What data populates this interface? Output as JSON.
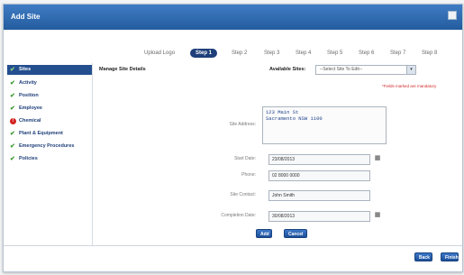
{
  "window": {
    "title": "Add Site"
  },
  "steps": [
    {
      "label": "Upload Logo",
      "current": false
    },
    {
      "label": "Step 1",
      "current": true
    },
    {
      "label": "Step 2",
      "current": false
    },
    {
      "label": "Step 3",
      "current": false
    },
    {
      "label": "Step 4",
      "current": false
    },
    {
      "label": "Step 5",
      "current": false
    },
    {
      "label": "Step 6",
      "current": false
    },
    {
      "label": "Step 7",
      "current": false
    },
    {
      "label": "Step 8",
      "current": false
    }
  ],
  "sidebar": {
    "items": [
      {
        "label": "Sites",
        "status": "active"
      },
      {
        "label": "Activity",
        "status": "complete",
        "icon": "check-icon"
      },
      {
        "label": "Position",
        "status": "complete",
        "icon": "check-icon"
      },
      {
        "label": "Employee",
        "status": "complete",
        "icon": "check-icon"
      },
      {
        "label": "Chemical",
        "status": "error",
        "icon": "error-icon"
      },
      {
        "label": "Plant & Equipment",
        "status": "complete",
        "icon": "check-icon"
      },
      {
        "label": "Emergency Procedures",
        "status": "complete",
        "icon": "check-icon"
      },
      {
        "label": "Policies",
        "status": "complete",
        "icon": "check-icon"
      }
    ]
  },
  "main": {
    "section_title": "Manage Site Details",
    "available_sites_label": "Available Sites:",
    "site_select_value": "--Select Site To Edit--",
    "required_note": "*Fields marked are mandatory",
    "fields": {
      "address_label": "Site Address:",
      "address_value": "123 Main St\nSacramento NSW 1100",
      "start_date_label": "Start Date:",
      "start_date_value": "23/08/2013",
      "phone_label": "Phone:",
      "phone_value": "02 8000 0000",
      "contact_label": "Site Contact:",
      "contact_value": "John Smith",
      "completion_label": "Completion Date:",
      "completion_value": "30/08/2013"
    },
    "add_button": "Add",
    "cancel_button": "Cancel"
  },
  "footer": {
    "back_button": "Back",
    "finish_button": "Finish"
  },
  "colors": {
    "titlebar": "#2f6bb3",
    "accent": "#1e3f79",
    "check": "#3a9a2f",
    "error": "#d32121"
  }
}
